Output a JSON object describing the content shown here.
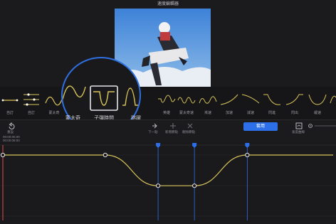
{
  "window": {
    "title": "速度編輯器"
  },
  "presets": {
    "items": [
      {
        "label": "自訂",
        "icon": "curve-custom-icon"
      },
      {
        "label": "自訂",
        "icon": "curve-slider-icon"
      },
      {
        "label": "蒙太奇",
        "icon": "curve-wave-icon"
      },
      {
        "label": "子彈時間",
        "icon": "curve-dip-icon"
      },
      {
        "label": "跳躍",
        "icon": "curve-bump-icon"
      },
      {
        "label": "英雄",
        "icon": "curve-hero-icon"
      },
      {
        "label": "蒙太奇速",
        "icon": "curve-multiwave-icon"
      },
      {
        "label": "漸速",
        "icon": "curve-ramp-icon"
      },
      {
        "label": "加速",
        "icon": "curve-accel-icon"
      },
      {
        "label": "減速",
        "icon": "curve-decel-icon"
      },
      {
        "label": "閃進",
        "icon": "curve-flash-in-icon"
      },
      {
        "label": "閃出",
        "icon": "curve-flash-out-icon"
      },
      {
        "label": "緩速",
        "icon": "curve-ease-icon"
      }
    ],
    "magnified": {
      "left": "蒙太奇",
      "center": "子彈時間",
      "right": "跳躍"
    }
  },
  "toolbar": {
    "reset_label": "重設",
    "time": "00:00:00.00",
    "duration": "00:00:08:00",
    "next_label": "下一點",
    "add_label": "新增節點",
    "delete_label": "刪除節點",
    "apply_label": "套用",
    "speed_label": "速度曲線"
  },
  "graph": {
    "keyframes": [
      {
        "t": 0.0,
        "speed": 1.0
      },
      {
        "t": 0.31,
        "speed": 1.0
      },
      {
        "t": 0.47,
        "speed": 0.2
      },
      {
        "t": 0.58,
        "speed": 0.2
      },
      {
        "t": 0.74,
        "speed": 1.0
      },
      {
        "t": 1.0,
        "speed": 1.0
      }
    ],
    "markers_t": [
      0.47,
      0.58,
      0.74
    ]
  },
  "colors": {
    "accent": "#2d6fe8",
    "curve": "#d8c45a",
    "marker": "#2d6fe8"
  }
}
